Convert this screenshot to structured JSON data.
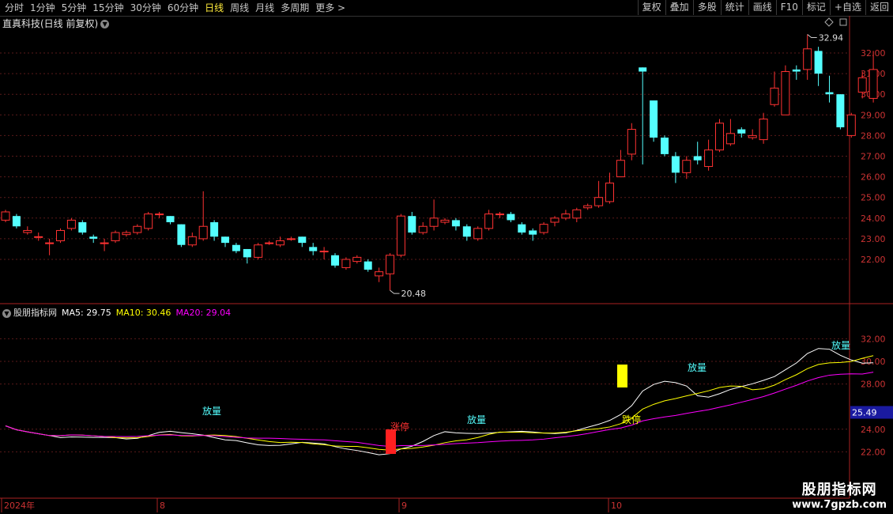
{
  "toolbar": {
    "periods": [
      "分时",
      "1分钟",
      "5分钟",
      "15分钟",
      "30分钟",
      "60分钟",
      "日线",
      "周线",
      "月线",
      "多周期",
      "更多"
    ],
    "active_period": "日线",
    "more_arrow": ">",
    "actions": [
      "复权",
      "叠加",
      "多股",
      "统计",
      "画线",
      "F10",
      "标记",
      "+自选",
      "返回"
    ]
  },
  "main_chart": {
    "title": "直真科技(日线 前复权)",
    "high_label": "32.94",
    "low_label": "20.48",
    "y_ticks": [
      "32.00",
      "31.00",
      "30.00",
      "29.00",
      "28.00",
      "27.00",
      "26.00",
      "25.00",
      "24.00",
      "23.00",
      "22.00"
    ]
  },
  "indicator": {
    "title": "股朋指标网",
    "ma5_label": "MA5: 29.75",
    "ma10_label": "MA10: 30.46",
    "ma20_label": "MA20: 29.04",
    "y_ticks": [
      "32.00",
      "30.00",
      "28.00",
      "24.00",
      "22.00"
    ],
    "current_value": "25.49",
    "annotations": [
      "放量",
      "涨停",
      "放量",
      "跌停",
      "放量",
      "放量"
    ]
  },
  "x_axis": {
    "labels": [
      "2024年",
      "8",
      "9",
      "10"
    ]
  },
  "watermark": {
    "line1": "股朋指标网",
    "line2": "www.7gpzb.com"
  },
  "chart_data": {
    "type": "candlestick",
    "ohlc": [
      [
        23.9,
        24.3,
        24.4,
        23.8
      ],
      [
        24.1,
        23.6,
        24.2,
        23.5
      ],
      [
        23.3,
        23.4,
        23.6,
        23.2
      ],
      [
        23.1,
        23.1,
        23.3,
        22.9
      ],
      [
        22.8,
        22.8,
        23.0,
        22.2
      ],
      [
        22.9,
        23.4,
        23.5,
        22.8
      ],
      [
        23.5,
        23.9,
        24.0,
        23.4
      ],
      [
        23.8,
        23.3,
        23.9,
        23.2
      ],
      [
        23.1,
        23.0,
        23.2,
        22.8
      ],
      [
        22.8,
        22.8,
        23.0,
        22.4
      ],
      [
        22.9,
        23.3,
        23.4,
        22.8
      ],
      [
        23.2,
        23.3,
        23.4,
        23.1
      ],
      [
        23.3,
        23.6,
        23.7,
        23.2
      ],
      [
        23.5,
        24.2,
        24.3,
        23.4
      ],
      [
        24.2,
        24.2,
        24.3,
        24.0
      ],
      [
        24.1,
        23.8,
        24.1,
        23.7
      ],
      [
        23.7,
        22.7,
        23.7,
        22.6
      ],
      [
        22.7,
        23.1,
        23.3,
        22.6
      ],
      [
        23.0,
        23.6,
        25.3,
        22.9
      ],
      [
        23.8,
        23.1,
        23.9,
        22.9
      ],
      [
        23.1,
        22.8,
        23.1,
        22.6
      ],
      [
        22.7,
        22.4,
        22.8,
        22.3
      ],
      [
        22.5,
        22.1,
        22.5,
        21.8
      ],
      [
        22.1,
        22.7,
        22.8,
        22.0
      ],
      [
        22.8,
        22.8,
        22.9,
        22.7
      ],
      [
        22.7,
        22.9,
        23.1,
        22.6
      ],
      [
        23.0,
        23.0,
        23.1,
        22.9
      ],
      [
        23.1,
        22.8,
        23.1,
        22.6
      ],
      [
        22.6,
        22.4,
        22.8,
        22.2
      ],
      [
        22.4,
        22.4,
        22.6,
        22.0
      ],
      [
        22.2,
        21.7,
        22.3,
        21.6
      ],
      [
        21.6,
        22.0,
        22.1,
        21.5
      ],
      [
        21.9,
        22.1,
        22.2,
        21.8
      ],
      [
        21.9,
        21.5,
        22.0,
        21.4
      ],
      [
        21.2,
        21.4,
        21.6,
        20.9
      ],
      [
        21.3,
        22.2,
        22.3,
        20.5
      ],
      [
        22.2,
        24.1,
        24.2,
        22.1
      ],
      [
        24.1,
        23.3,
        24.3,
        23.2
      ],
      [
        23.3,
        23.6,
        23.8,
        23.2
      ],
      [
        23.6,
        24.0,
        24.9,
        23.4
      ],
      [
        23.8,
        23.9,
        24.0,
        23.7
      ],
      [
        23.9,
        23.6,
        24.0,
        23.4
      ],
      [
        23.6,
        23.1,
        23.7,
        22.9
      ],
      [
        23.0,
        23.5,
        23.6,
        22.9
      ],
      [
        23.5,
        24.2,
        24.4,
        23.4
      ],
      [
        24.2,
        24.2,
        24.3,
        24.0
      ],
      [
        24.2,
        23.9,
        24.3,
        23.8
      ],
      [
        23.7,
        23.3,
        23.8,
        23.2
      ],
      [
        23.4,
        23.2,
        23.5,
        22.9
      ],
      [
        23.3,
        23.7,
        23.8,
        23.2
      ],
      [
        23.8,
        24.0,
        24.1,
        23.6
      ],
      [
        24.0,
        24.2,
        24.4,
        23.9
      ],
      [
        24.0,
        24.4,
        24.5,
        23.8
      ],
      [
        24.5,
        24.6,
        24.7,
        24.4
      ],
      [
        24.6,
        25.0,
        25.8,
        24.5
      ],
      [
        24.8,
        25.7,
        26.2,
        24.7
      ],
      [
        26.0,
        26.8,
        27.3,
        26.0
      ],
      [
        27.1,
        28.3,
        28.6,
        26.8
      ],
      [
        31.3,
        31.1,
        31.3,
        26.6
      ],
      [
        29.7,
        27.9,
        29.7,
        27.7
      ],
      [
        27.9,
        27.1,
        28.0,
        27.0
      ],
      [
        27.0,
        26.2,
        27.2,
        25.7
      ],
      [
        26.2,
        26.8,
        27.0,
        25.9
      ],
      [
        27.0,
        26.8,
        27.7,
        26.6
      ],
      [
        26.5,
        27.3,
        27.8,
        26.3
      ],
      [
        27.3,
        28.6,
        28.8,
        27.2
      ],
      [
        27.6,
        28.1,
        28.8,
        27.5
      ],
      [
        28.3,
        28.1,
        28.4,
        27.9
      ],
      [
        27.9,
        28.0,
        28.3,
        27.8
      ],
      [
        27.8,
        28.8,
        29.1,
        27.6
      ],
      [
        29.5,
        30.3,
        31.1,
        29.4
      ],
      [
        29.0,
        31.1,
        31.4,
        29.0
      ],
      [
        31.2,
        31.1,
        31.4,
        30.7
      ],
      [
        31.2,
        32.2,
        32.9,
        30.7
      ],
      [
        32.1,
        31.0,
        32.3,
        30.4
      ],
      [
        30.1,
        30.0,
        30.9,
        29.6
      ],
      [
        30.0,
        28.4,
        30.0,
        28.3
      ],
      [
        28.0,
        29.0,
        29.1,
        27.9
      ],
      [
        30.1,
        30.8,
        31.1,
        29.8
      ],
      [
        29.8,
        31.2,
        32.1,
        29.6
      ]
    ],
    "indicator_lines": [
      {
        "name": "MA5",
        "color": "#ffffff"
      },
      {
        "name": "MA10",
        "color": "#ffff00"
      },
      {
        "name": "MA20",
        "color": "#ff00ff"
      }
    ]
  }
}
